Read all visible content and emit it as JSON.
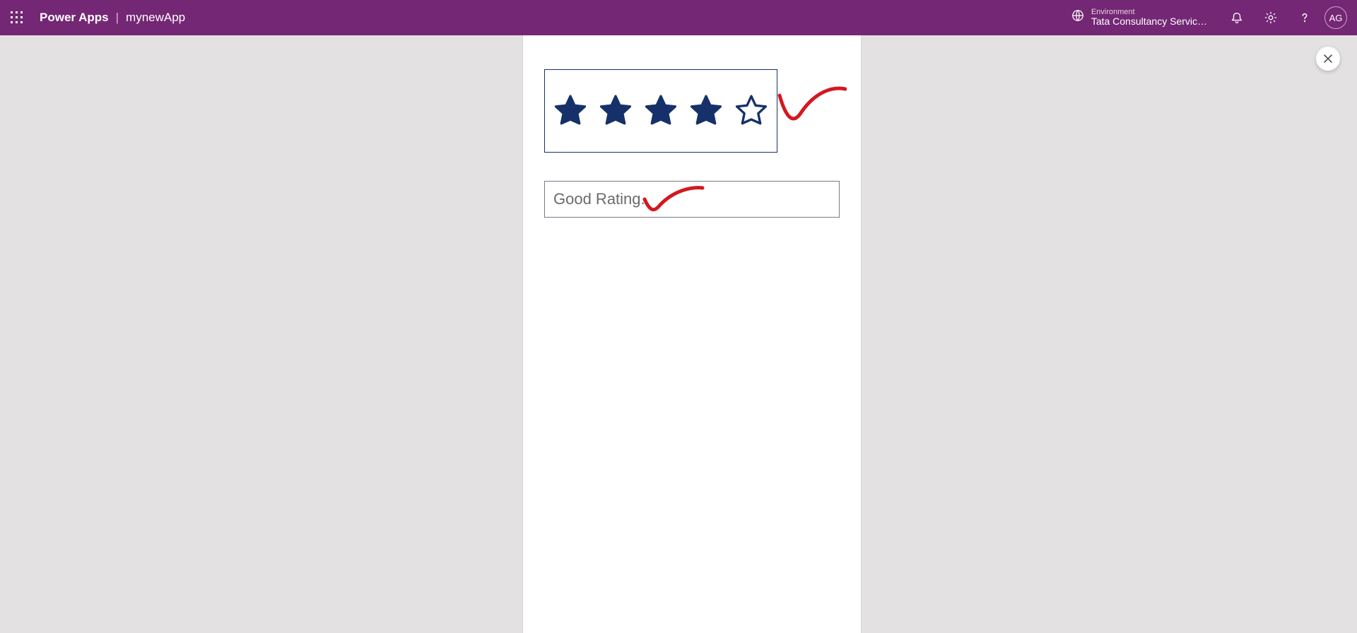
{
  "header": {
    "product": "Power Apps",
    "app_name": "mynewApp",
    "environment_label": "Environment",
    "environment_name": "Tata Consultancy Servic…",
    "avatar_initials": "AG"
  },
  "canvas": {
    "rating": {
      "value": 4,
      "max": 5,
      "star_color": "#16316a"
    },
    "textbox_value": "Good Rating."
  },
  "icons": {
    "waffle": "waffle-icon",
    "globe": "globe-icon",
    "bell": "bell-icon",
    "gear": "gear-icon",
    "help": "help-icon",
    "close": "close-icon"
  }
}
